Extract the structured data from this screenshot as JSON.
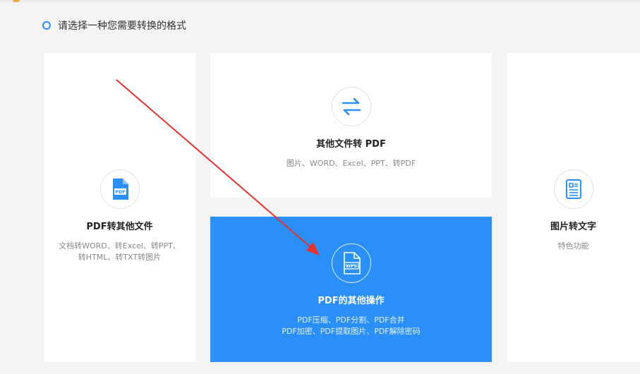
{
  "heading": {
    "text": "请选择一种您需要转换的格式"
  },
  "cards": [
    {
      "title": "PDF转其他文件",
      "desc_line1": "文档转WORD、转Excel、转PPT、",
      "desc_line2": "转HTML、转TXT转图片",
      "icon": "pdf-file-icon"
    },
    {
      "title": "其他文件转 PDF",
      "desc_line1": "图片、WORD、Excel、PPT、转PDF",
      "icon": "swap-arrows-icon"
    },
    {
      "title": "PDF的其他操作",
      "desc_line1": "PDF压缩、PDF分割、PDF合并",
      "desc_line2": "PDF加密、PDF提取图片、PDF解除密码",
      "icon": "wps-file-icon",
      "active": true
    },
    {
      "title": "图片转文字",
      "desc_line1": "特色功能",
      "icon": "document-text-icon"
    }
  ],
  "icon_labels": {
    "pdf": "PDF",
    "wps": "WPS"
  },
  "colors": {
    "accent": "#2a8ff7",
    "annotation_arrow": "#e8312b",
    "background": "#f4f4f4"
  }
}
